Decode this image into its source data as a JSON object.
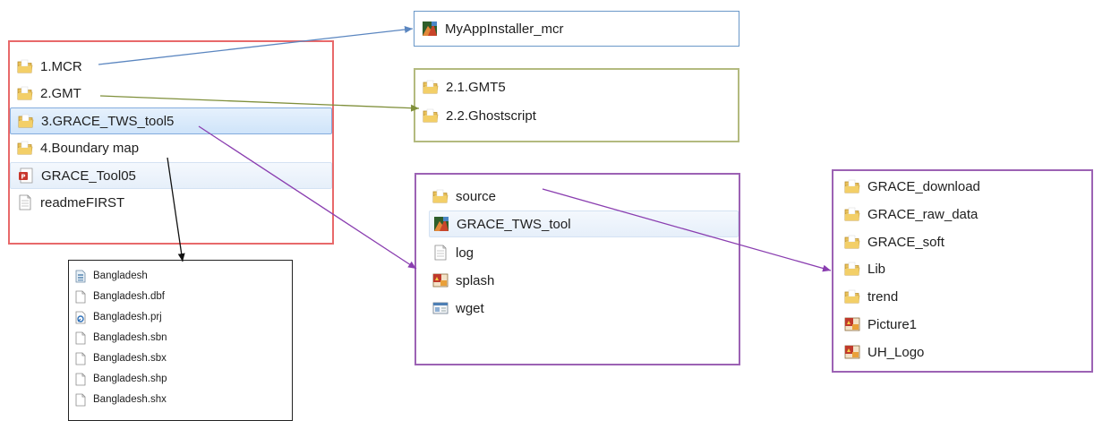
{
  "colors": {
    "main_border": "#e8696a",
    "mcr_border": "#6a98c8",
    "gmt_border": "#b3ba7f",
    "purple_border": "#9c62b4",
    "black_border": "#222222",
    "arrow_blue": "#5b86c0",
    "arrow_green": "#7f8f3a",
    "arrow_purple": "#8a3eb0",
    "arrow_black": "#111111"
  },
  "main_folder": {
    "items": [
      {
        "label": "1.MCR",
        "icon": "folder-icon"
      },
      {
        "label": "2.GMT",
        "icon": "folder-icon"
      },
      {
        "label": "3.GRACE_TWS_tool5",
        "icon": "folder-icon"
      },
      {
        "label": "4.Boundary map",
        "icon": "folder-icon"
      },
      {
        "label": "GRACE_Tool05",
        "icon": "pdf-icon"
      },
      {
        "label": "readmeFIRST",
        "icon": "text-file-icon"
      }
    ]
  },
  "mcr_folder": {
    "items": [
      {
        "label": "MyAppInstaller_mcr",
        "icon": "matlab-app-icon"
      }
    ]
  },
  "gmt_folder": {
    "items": [
      {
        "label": "2.1.GMT5",
        "icon": "folder-icon"
      },
      {
        "label": "2.2.Ghostscript",
        "icon": "folder-icon"
      }
    ]
  },
  "tool_folder": {
    "items": [
      {
        "label": "source",
        "icon": "folder-icon"
      },
      {
        "label": "GRACE_TWS_tool",
        "icon": "matlab-app-icon"
      },
      {
        "label": "log",
        "icon": "text-file-icon"
      },
      {
        "label": "splash",
        "icon": "image-icon"
      },
      {
        "label": "wget",
        "icon": "application-icon"
      }
    ]
  },
  "source_folder": {
    "items": [
      {
        "label": "GRACE_download",
        "icon": "folder-icon"
      },
      {
        "label": "GRACE_raw_data",
        "icon": "folder-icon"
      },
      {
        "label": "GRACE_soft",
        "icon": "folder-icon"
      },
      {
        "label": "Lib",
        "icon": "folder-icon"
      },
      {
        "label": "trend",
        "icon": "folder-icon"
      },
      {
        "label": "Picture1",
        "icon": "image-icon"
      },
      {
        "label": "UH_Logo",
        "icon": "image-icon"
      }
    ]
  },
  "boundary_folder": {
    "items": [
      {
        "label": "Bangladesh",
        "icon": "shapefile-icon"
      },
      {
        "label": "Bangladesh.dbf",
        "icon": "blank-file-icon"
      },
      {
        "label": "Bangladesh.prj",
        "icon": "prj-file-icon"
      },
      {
        "label": "Bangladesh.sbn",
        "icon": "blank-file-icon"
      },
      {
        "label": "Bangladesh.sbx",
        "icon": "blank-file-icon"
      },
      {
        "label": "Bangladesh.shp",
        "icon": "blank-file-icon"
      },
      {
        "label": "Bangladesh.shx",
        "icon": "blank-file-icon"
      }
    ]
  }
}
